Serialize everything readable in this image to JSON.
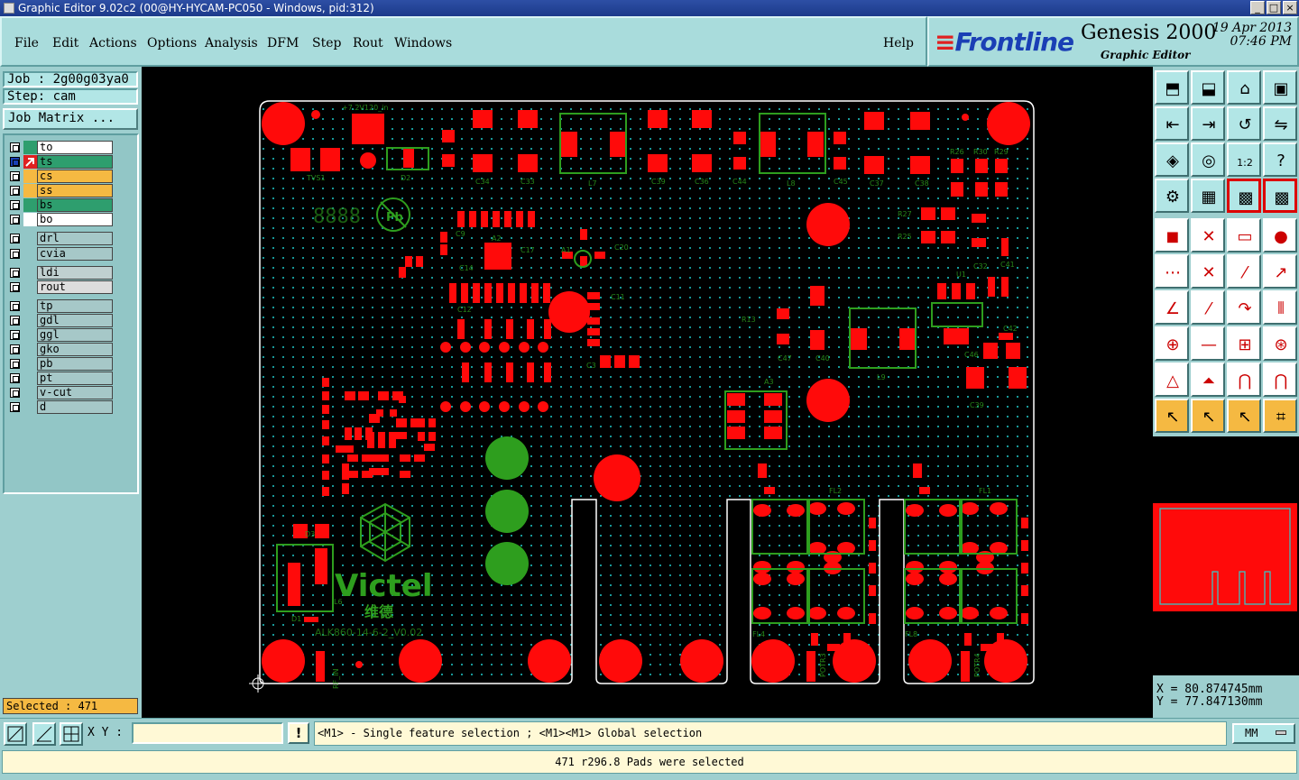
{
  "window": {
    "title": "Graphic Editor 9.02c2 (00@HY-HYCAM-PC050 - Windows, pid:312)",
    "minimize": "_",
    "maximize": "□",
    "close": "×"
  },
  "menu": {
    "file": "File",
    "edit": "Edit",
    "actions": "Actions",
    "options": "Options",
    "analysis": "Analysis",
    "dfm": "DFM",
    "step": "Step",
    "rout": "Rout",
    "windows": "Windows",
    "help": "Help"
  },
  "brand": {
    "logo": "Frontline",
    "product": "Genesis 2000",
    "subtitle": "Graphic Editor",
    "date": "19 Apr 2013",
    "time": "07:46 PM"
  },
  "job": {
    "job_label": "Job : 2g00g03ya0",
    "step_label": "Step: cam",
    "matrix_button": "Job Matrix ..."
  },
  "layers": [
    {
      "name": "to",
      "color": "#ffffff",
      "swatch": "#2e9e6e"
    },
    {
      "name": "ts",
      "color": "#2e9e6e",
      "swatch": "#e02020"
    },
    {
      "name": "cs",
      "color": "#f5b942",
      "swatch": "#f5b942"
    },
    {
      "name": "ss",
      "color": "#f5b942",
      "swatch": "#f5b942"
    },
    {
      "name": "bs",
      "color": "#2e9e6e",
      "swatch": "#2e9e6e"
    },
    {
      "name": "bo",
      "color": "#ffffff",
      "swatch": "#ffffff"
    },
    {
      "name": "drl",
      "color": "#a6c8c8",
      "swatch": ""
    },
    {
      "name": "cvia",
      "color": "#a6c8c8",
      "swatch": ""
    },
    {
      "name": "ldi",
      "color": "#c0d0d0",
      "swatch": ""
    },
    {
      "name": "rout",
      "color": "#dddddd",
      "swatch": ""
    },
    {
      "name": "tp",
      "color": "#a6c8c8",
      "swatch": ""
    },
    {
      "name": "gdl",
      "color": "#a6c8c8",
      "swatch": ""
    },
    {
      "name": "ggl",
      "color": "#a6c8c8",
      "swatch": ""
    },
    {
      "name": "gko",
      "color": "#a6c8c8",
      "swatch": ""
    },
    {
      "name": "pb",
      "color": "#a6c8c8",
      "swatch": ""
    },
    {
      "name": "pt",
      "color": "#a6c8c8",
      "swatch": ""
    },
    {
      "name": "v-cut",
      "color": "#a6c8c8",
      "swatch": ""
    },
    {
      "name": "d",
      "color": "#a6c8c8",
      "swatch": ""
    }
  ],
  "selection": {
    "count_label": "Selected : 471"
  },
  "coords": {
    "x": "X = 80.874745mm",
    "y": "Y = 77.847130mm"
  },
  "bottom": {
    "xy_label": "X Y :",
    "xy_value": "",
    "alert": "!",
    "message": "<M1> - Single feature selection ; <M1><M1> Global selection",
    "units": "MM"
  },
  "status": {
    "text": "471 r296.8 Pads were selected"
  },
  "board": {
    "top_label": "+7.2V120_in",
    "tvs": "TVS1",
    "d2": "D2",
    "c43": "C43",
    "c34": "C34",
    "c33": "C33",
    "l7": "L7",
    "c39": "C39",
    "c36": "C36",
    "c44": "C44",
    "l8": "L8",
    "c45": "C45",
    "c37": "C37",
    "c38": "C38",
    "r26": "R26",
    "r30": "R30",
    "r29": "R29",
    "r27": "R27",
    "r25": "R25",
    "c32": "C32",
    "c41": "C41",
    "u1": "U1",
    "c40": "C40",
    "c47": "C47",
    "l9": "L9",
    "c46": "C46",
    "c42": "C42",
    "c39b": "C39",
    "a3": "A3",
    "a2": "A2",
    "a1": "A1",
    "c9": "C9",
    "c12": "C12",
    "c14": "C14",
    "c17": "C17",
    "c20": "C20",
    "c11": "C11",
    "c3": "C3",
    "r13": "R13",
    "fl2": "FL2",
    "fl1": "FL1",
    "fl4": "FL4",
    "fl8": "FL8",
    "potr3": "POTR3",
    "potr4": "POTR4",
    "d3": "D3",
    "l6": "L6",
    "d1": "D1",
    "brand_text": "Victel",
    "brand_cn": "维德",
    "part_number": "ALK860-14-6-2_V0.02",
    "digits": "8888",
    "pb": "Pb",
    "rf_in": "RF_IN"
  }
}
